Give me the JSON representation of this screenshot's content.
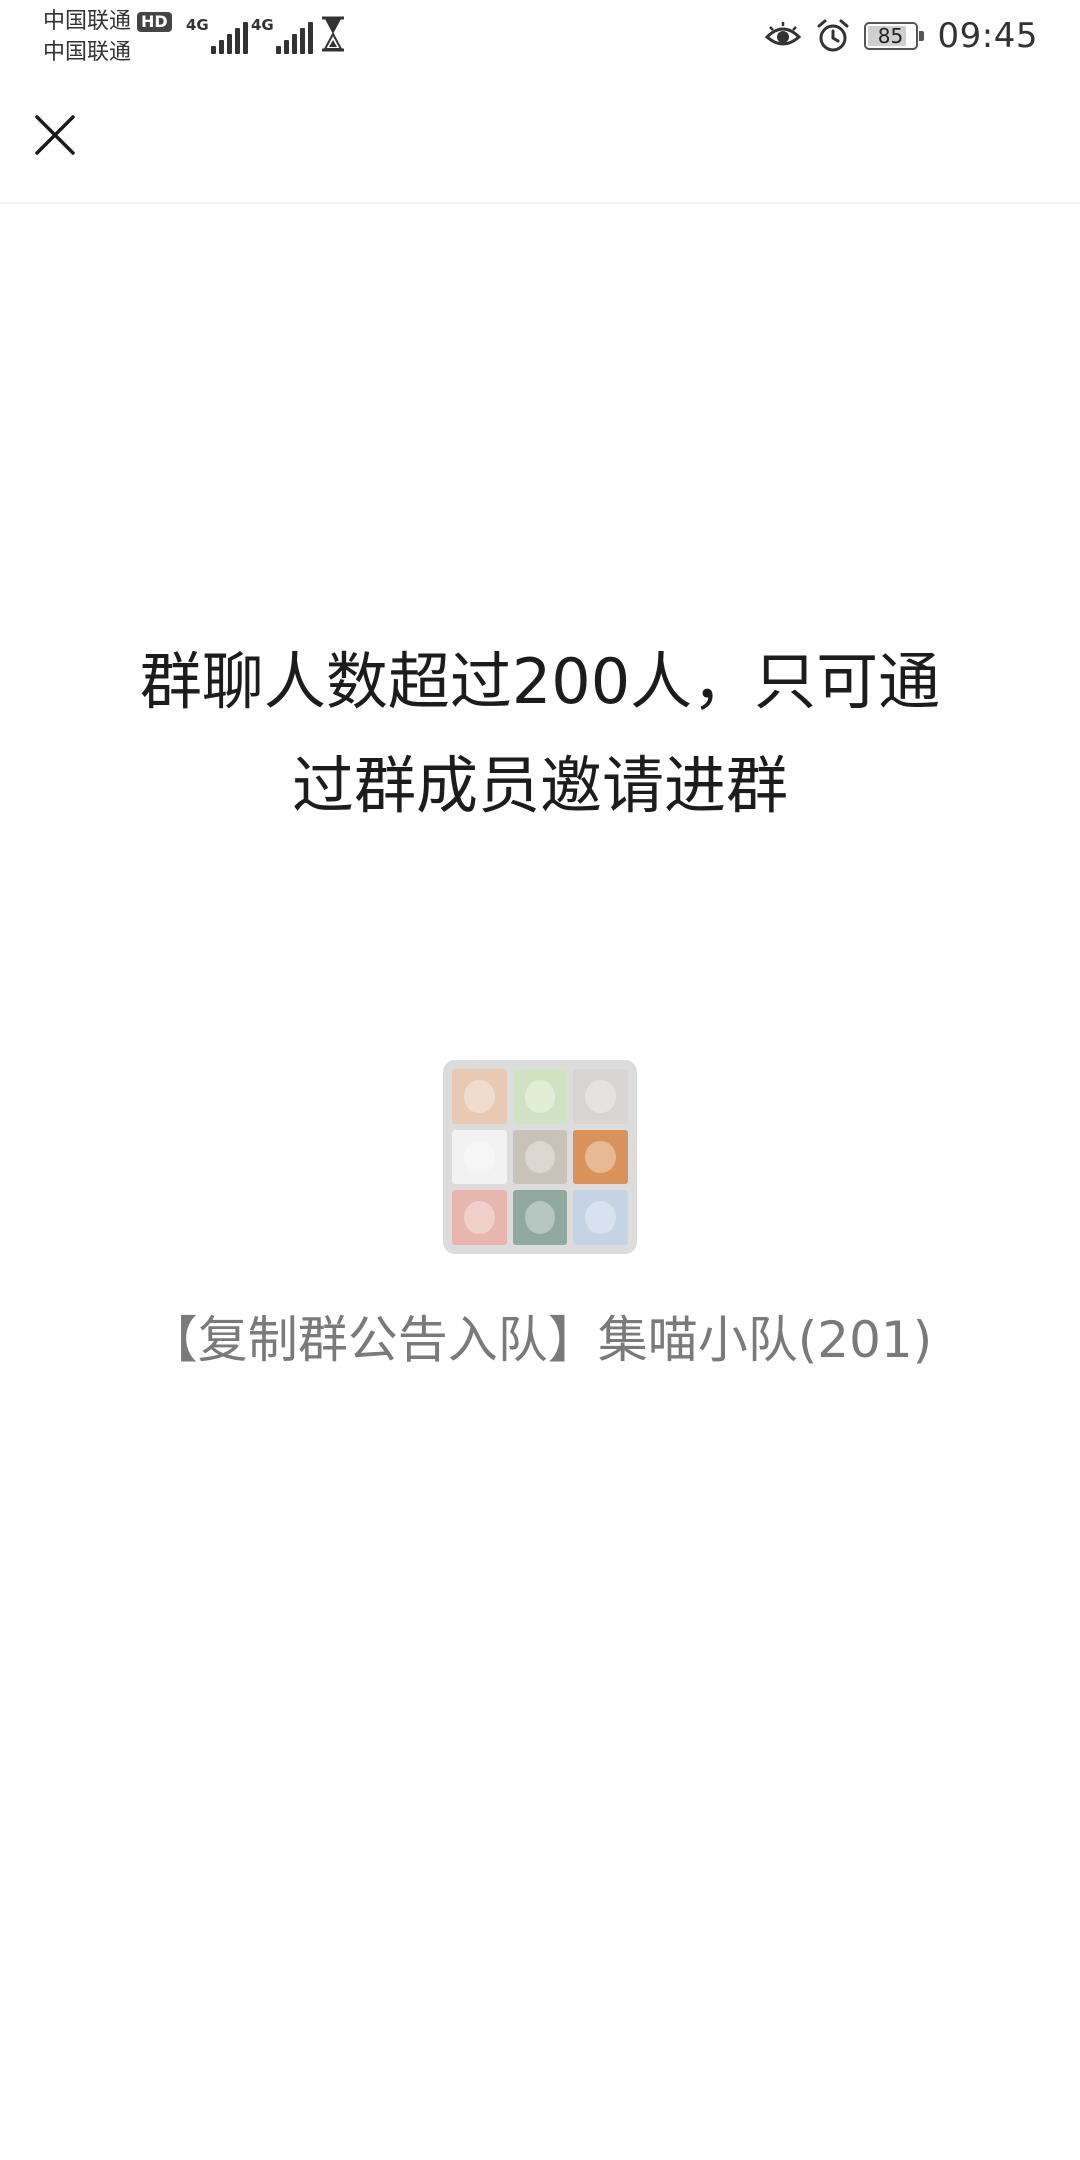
{
  "status_bar": {
    "carrier_1": "中国联通",
    "hd_badge": "HD",
    "carrier_2": "中国联通",
    "network_1": "4G",
    "network_2": "4G",
    "icons": [
      "signal-icon",
      "signal-icon",
      "hourglass-icon",
      "eye-icon",
      "alarm-icon",
      "battery-icon"
    ],
    "battery_level": "85",
    "time": "09:45"
  },
  "nav": {
    "close_icon": "close-icon"
  },
  "main": {
    "message_line_1": "群聊人数超过200人，只可通",
    "message_line_2": "过群成员邀请进群",
    "group_avatar_colors": [
      "#e8c9b3",
      "#cfe3c2",
      "#d8d4d2",
      "#f2f2f2",
      "#c9c2b8",
      "#d9925a",
      "#e7b7ae",
      "#8fa8a0",
      "#c4d3e6"
    ],
    "group_name": "【复制群公告入队】集喵小队(201)"
  }
}
